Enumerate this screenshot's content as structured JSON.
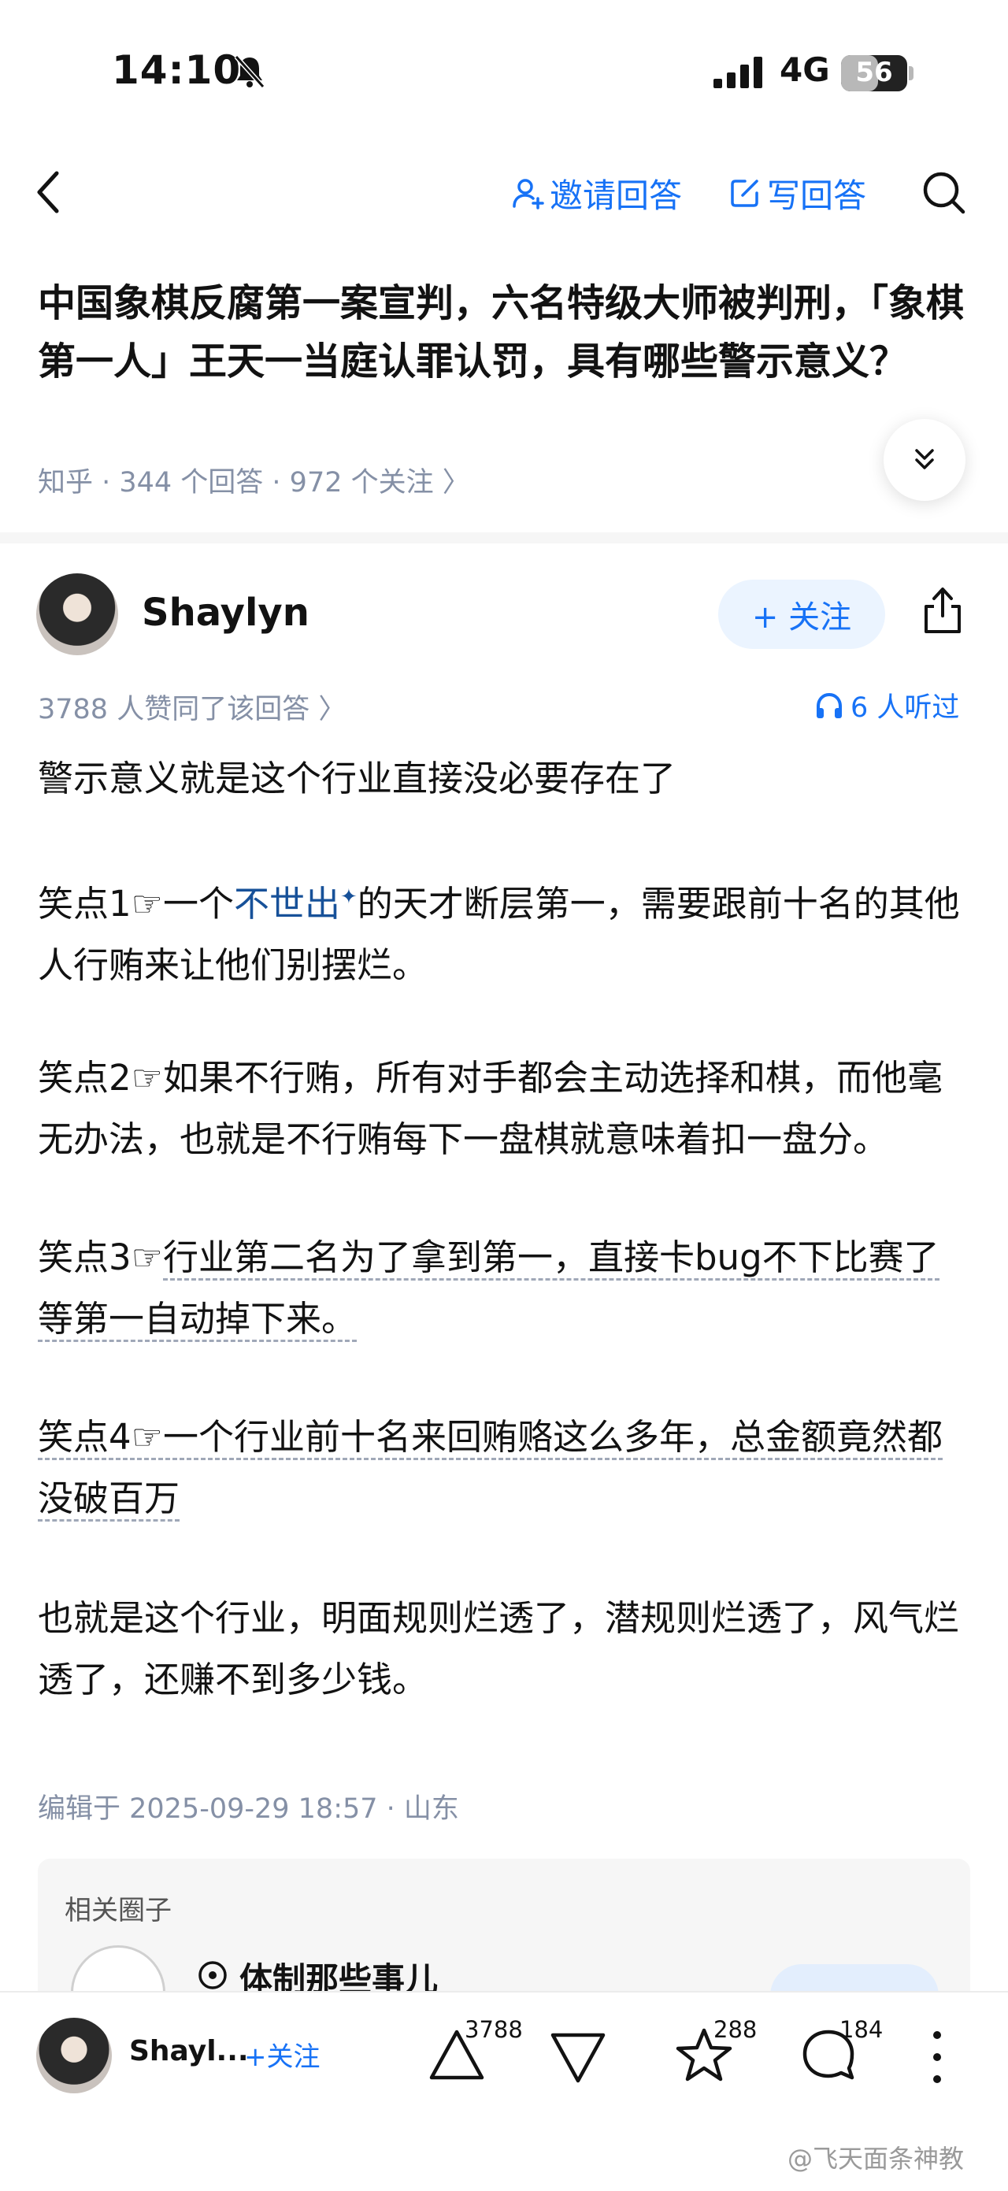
{
  "status_bar": {
    "time": "14:10",
    "network": "4G",
    "battery": "56",
    "battery_level": 0.56
  },
  "nav": {
    "invite_label": "邀请回答",
    "write_label": "写回答"
  },
  "question": {
    "title": "中国象棋反腐第一案宣判，六名特级大师被判刑，「象棋第一人」王天一当庭认罪认罚，具有哪些警示意义？",
    "meta": "知乎 · 344 个回答 · 972 个关注 〉"
  },
  "author": {
    "name": "Shaylyn",
    "follow_label": "+ 关注"
  },
  "answer": {
    "likes_line": "3788 人赞同了该回答 〉",
    "listen_label": "6 人听过",
    "p1": "警示意义就是这个行业直接没必要存在了",
    "p2_a": "笑点1☞一个",
    "p2_link": "不世出",
    "p2_b": "的天才断层第一，需要跟前十名的其他人行贿来让他们别摆烂。",
    "p3": "笑点2☞如果不行贿，所有对手都会主动选择和棋，而他毫无办法，也就是不行贿每下一盘棋就意味着扣一盘分。",
    "p4_a": "笑点3☞",
    "p4_b": "行业第二名为了拿到第一，直接卡bug不下比赛了等第一自动掉下来。",
    "p5": "笑点4☞一个行业前十名来回贿赂这么多年，总金额竟然都没破百万",
    "p6": "也就是这个行业，明面规则烂透了，潜规则烂透了，风气烂透了，还赚不到多少钱。",
    "edit_line": "编辑于 2025-09-29 18:57 · 山东"
  },
  "related": {
    "title": "相关圈子",
    "circle_name": "体制那些事儿"
  },
  "bottom_bar": {
    "author_short": "Shayl...",
    "follow_label": "+关注",
    "upvotes": "3788",
    "favorites": "288",
    "comments": "184"
  },
  "watermark": "@飞天面条神教"
}
